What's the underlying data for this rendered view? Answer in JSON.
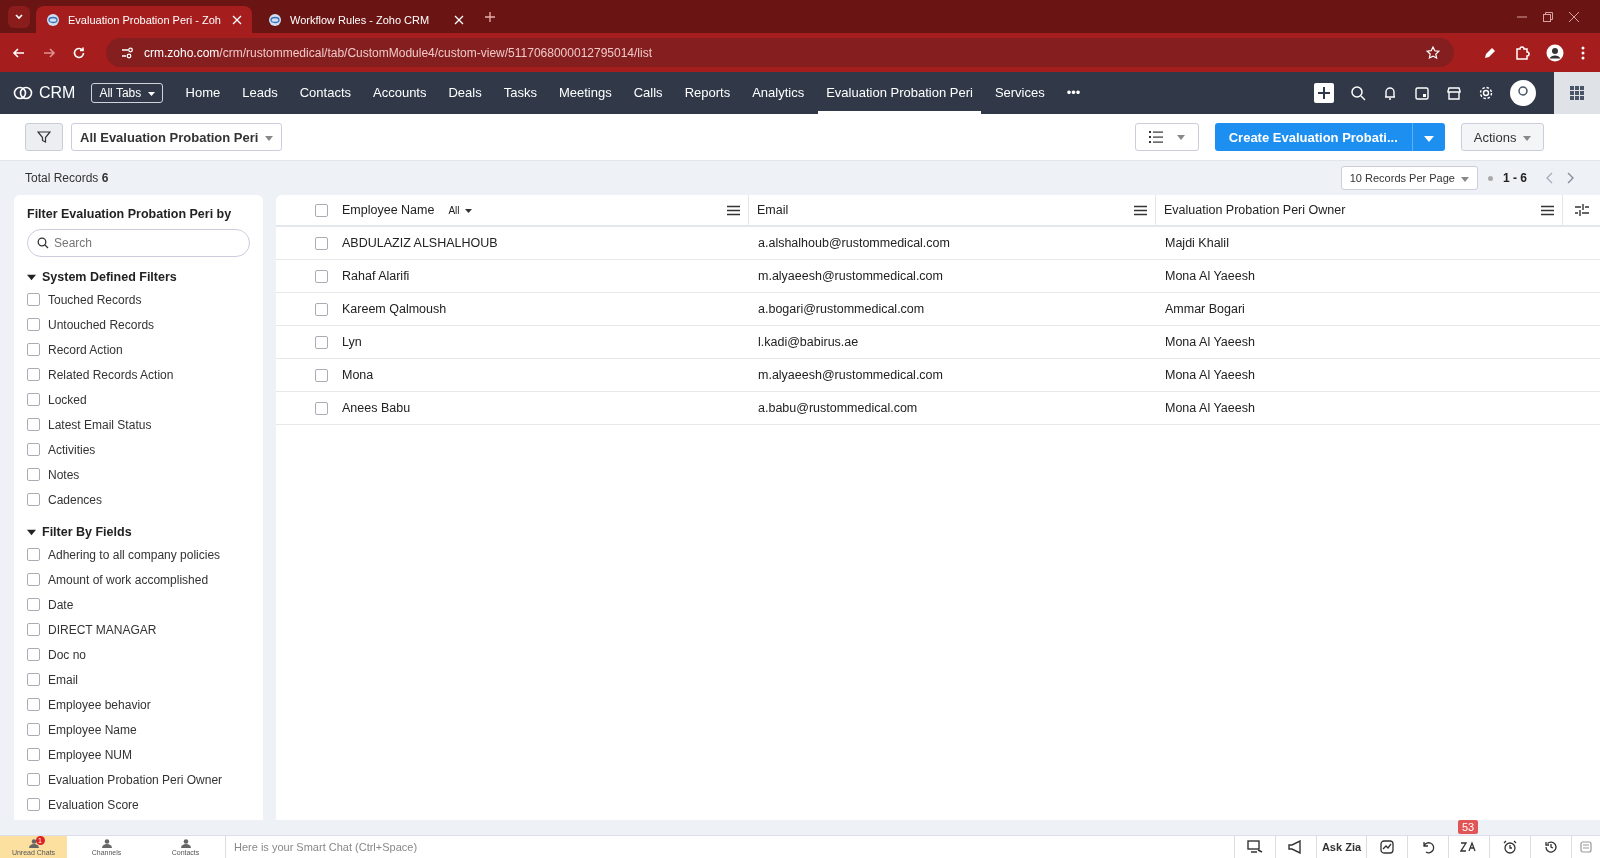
{
  "browser": {
    "tabs": [
      {
        "title": "Evaluation Probation Peri - Zoh",
        "selected": true
      },
      {
        "title": "Workflow Rules - Zoho CRM",
        "selected": false
      }
    ],
    "url_host": "crm.zoho.com",
    "url_path": "/crm/rustommedical/tab/CustomModule4/custom-view/5117068000012795014/list"
  },
  "nav": {
    "logo": "CRM",
    "all_tabs": "All Tabs",
    "items": [
      {
        "label": "Home",
        "selected": false
      },
      {
        "label": "Leads",
        "selected": false
      },
      {
        "label": "Contacts",
        "selected": false
      },
      {
        "label": "Accounts",
        "selected": false
      },
      {
        "label": "Deals",
        "selected": false
      },
      {
        "label": "Tasks",
        "selected": false
      },
      {
        "label": "Meetings",
        "selected": false
      },
      {
        "label": "Calls",
        "selected": false
      },
      {
        "label": "Reports",
        "selected": false
      },
      {
        "label": "Analytics",
        "selected": false
      },
      {
        "label": "Evaluation Probation Peri",
        "selected": true
      },
      {
        "label": "Services",
        "selected": false
      }
    ],
    "more": "•••"
  },
  "toolbar": {
    "view": "All Evaluation Probation Peri",
    "create": "Create Evaluation Probati...",
    "actions": "Actions"
  },
  "summary": {
    "label": "Total Records",
    "count": "6",
    "per_page": "10 Records Per Page",
    "range": "1 - 6"
  },
  "sidebar": {
    "title": "Filter Evaluation Probation Peri by",
    "search_placeholder": "Search",
    "sections": [
      {
        "title": "System Defined Filters",
        "expanded": true,
        "items": [
          {
            "label": "Touched Records",
            "checked": false
          },
          {
            "label": "Untouched Records",
            "checked": false
          },
          {
            "label": "Record Action",
            "checked": false
          },
          {
            "label": "Related Records Action",
            "checked": false
          },
          {
            "label": "Locked",
            "checked": false
          },
          {
            "label": "Latest Email Status",
            "checked": false
          },
          {
            "label": "Activities",
            "checked": false
          },
          {
            "label": "Notes",
            "checked": false
          },
          {
            "label": "Cadences",
            "checked": false
          }
        ]
      },
      {
        "title": "Filter By Fields",
        "expanded": true,
        "items": [
          {
            "label": "Adhering to all company policies",
            "checked": false
          },
          {
            "label": "Amount of work accomplished",
            "checked": false
          },
          {
            "label": "Date",
            "checked": false
          },
          {
            "label": "DIRECT MANAGAR",
            "checked": false
          },
          {
            "label": "Doc no",
            "checked": false
          },
          {
            "label": "Email",
            "checked": false
          },
          {
            "label": "Employee behavior",
            "checked": false
          },
          {
            "label": "Employee Name",
            "checked": false
          },
          {
            "label": "Employee NUM",
            "checked": false
          },
          {
            "label": "Evaluation Probation Peri Owner",
            "checked": false
          },
          {
            "label": "Evaluation Score",
            "checked": false
          }
        ]
      }
    ]
  },
  "table": {
    "select_all_checked": false,
    "columns": [
      {
        "label": "Employee Name",
        "filter": "All"
      },
      {
        "label": "Email"
      },
      {
        "label": "Evaluation Probation Peri Owner"
      }
    ],
    "rows": [
      {
        "cells": [
          "ABDULAZIZ ALSHALHOUB",
          "a.alshalhoub@rustommedical.com",
          "Majdi Khalil"
        ],
        "selected": false
      },
      {
        "cells": [
          "Rahaf Alarifi",
          "m.alyaeesh@rustommedical.com",
          "Mona Al Yaeesh"
        ],
        "selected": false
      },
      {
        "cells": [
          "Kareem Qalmoush",
          "a.bogari@rustommedical.com",
          "Ammar Bogari"
        ],
        "selected": false
      },
      {
        "cells": [
          "Lyn",
          "l.kadi@babirus.ae",
          "Mona Al Yaeesh"
        ],
        "selected": false
      },
      {
        "cells": [
          "Mona",
          "m.alyaeesh@rustommedical.com",
          "Mona Al Yaeesh"
        ],
        "selected": false
      },
      {
        "cells": [
          "Anees Babu",
          "a.babu@rustommedical.com",
          "Mona Al Yaeesh"
        ],
        "selected": false
      }
    ]
  },
  "bottom_bar": {
    "tabs": [
      {
        "label": "Unread Chats",
        "badge": "1",
        "selected": true
      },
      {
        "label": "Channels",
        "selected": false
      },
      {
        "label": "Contacts",
        "selected": false
      }
    ],
    "chat_placeholder": "Here is your Smart Chat (Ctrl+Space)",
    "ask_zia": "Ask Zia",
    "notification_count": "53"
  }
}
